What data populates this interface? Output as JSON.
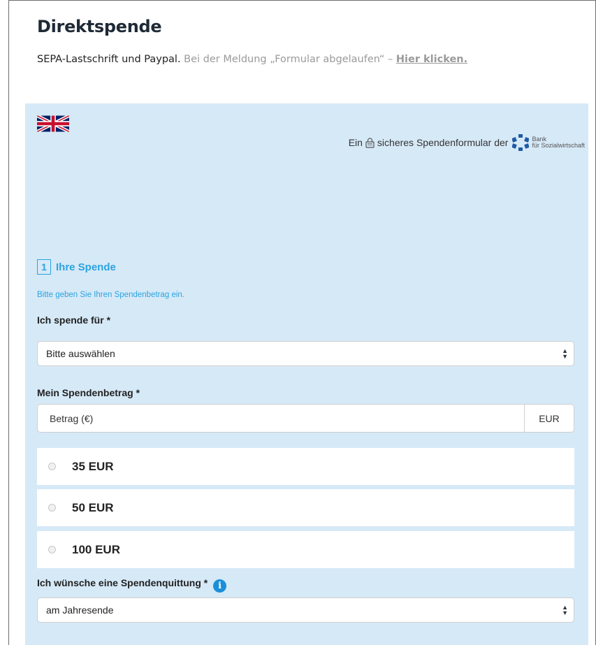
{
  "header": {
    "title": "Direktspende",
    "intro_main": "SEPA-Lastschrift und Paypal.",
    "intro_muted": "Bei der Meldung „Formular abgelaufen“ –",
    "intro_link": "Hier klicken."
  },
  "panel": {
    "secure_prefix": "Ein",
    "secure_suffix": "sicheres Spendenformular der",
    "bank_line1": "Bank",
    "bank_line2": "für Sozialwirtschaft"
  },
  "step": {
    "number": "1",
    "label": "Ihre Spende",
    "hint": "Bitte geben Sie Ihren Spendenbetrag ein."
  },
  "form": {
    "purpose_label": "Ich spende für *",
    "purpose_value": "Bitte auswählen",
    "amount_label": "Mein Spendenbetrag *",
    "amount_placeholder": "Betrag (€)",
    "amount_unit": "EUR",
    "options": [
      "35 EUR",
      "50 EUR",
      "100 EUR"
    ],
    "receipt_label": "Ich wünsche eine Spendenquittung *",
    "receipt_value": "am Jahresende"
  },
  "colors": {
    "panel_bg": "#d6e9f7",
    "accent": "#2ba3e0",
    "info": "#1a8fd8"
  },
  "icons": [
    "uk-flag-icon",
    "lock-icon",
    "bank-logo-icon",
    "info-icon",
    "select-arrows-icon"
  ]
}
